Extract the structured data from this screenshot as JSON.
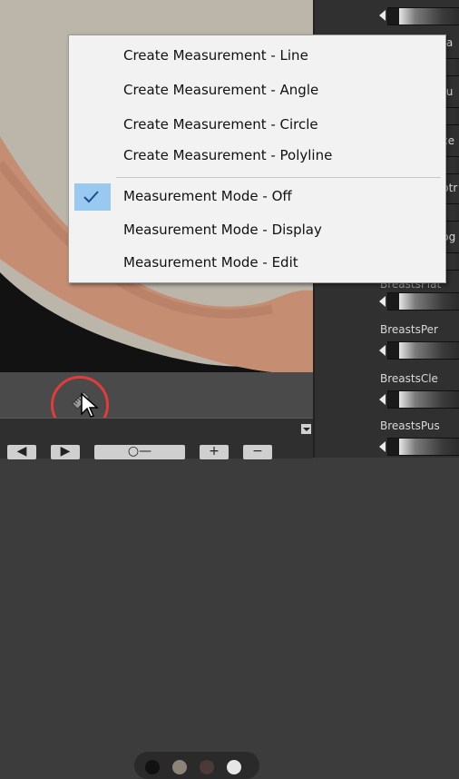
{
  "menu": {
    "items": [
      {
        "label": "Create Measurement - Line",
        "checked": false
      },
      {
        "label": "Create Measurement - Angle",
        "checked": false
      },
      {
        "label": "Create Measurement - Circle",
        "checked": false
      },
      {
        "label": "Create Measurement - Polyline",
        "checked": false
      },
      {
        "label": "Measurement Mode - Off",
        "checked": true
      },
      {
        "label": "Measurement Mode - Display",
        "checked": false
      },
      {
        "label": "Measurement Mode - Edit",
        "checked": false
      }
    ]
  },
  "right_panel": {
    "params": [
      {
        "label": "BreastsPer"
      },
      {
        "label": "BreastsCle"
      },
      {
        "label": "BreastsPus"
      }
    ],
    "partial_labels": [
      "ra",
      "tu",
      "ce",
      "ptr",
      "pg",
      "BreastsFlat"
    ]
  },
  "dots": {
    "colors": [
      "#111111",
      "#8c8478",
      "#4a3a3a",
      "#e6e6e6"
    ]
  },
  "bottom_buttons": [
    "◀",
    "▶",
    "○—",
    "+",
    "−"
  ],
  "colors": {
    "menu_check_highlight": "#99c9ef",
    "highlight_circle": "#e23b3b"
  }
}
